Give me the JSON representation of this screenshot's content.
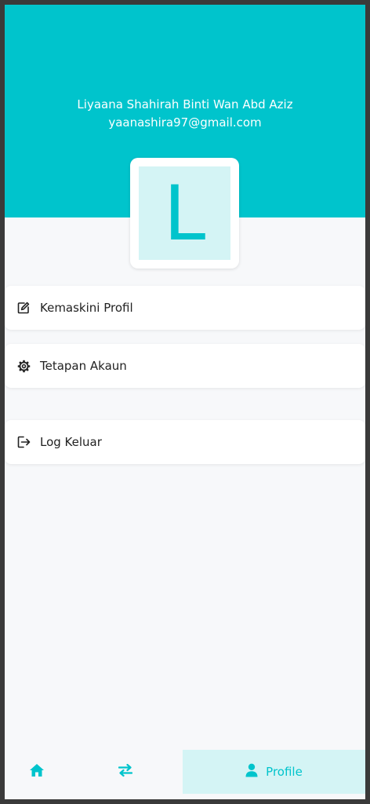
{
  "profile": {
    "name": "Liyaana Shahirah Binti Wan Abd Aziz",
    "email": "yaanashira97@gmail.com",
    "avatar_letter": "L"
  },
  "menu": {
    "items": [
      {
        "label": "Kemaskini Profil",
        "icon": "edit-icon"
      },
      {
        "label": "Tetapan Akaun",
        "icon": "gear-icon"
      },
      {
        "label": "Log Keluar",
        "icon": "logout-icon"
      }
    ]
  },
  "bottom_nav": {
    "items": [
      {
        "icon": "home-icon",
        "label": ""
      },
      {
        "icon": "transfer-icon",
        "label": ""
      },
      {
        "icon": "user-icon",
        "label": "Profile"
      }
    ],
    "active_index": 2
  },
  "colors": {
    "accent": "#00c4cc",
    "accent_light": "#d4f4f5",
    "background": "#f7f8fa"
  }
}
